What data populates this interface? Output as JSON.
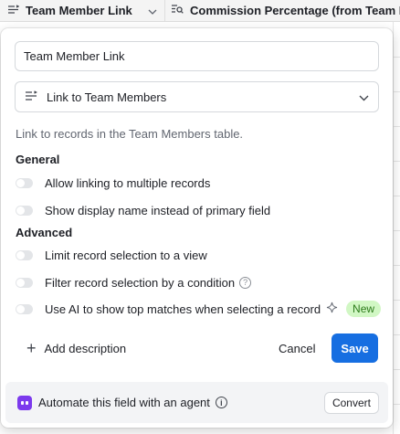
{
  "header": {
    "col1_label": "Team Member Link",
    "col1_icon": "linked-record-icon",
    "col2_label": "Commission Percentage (from Team Me",
    "col2_icon": "lookup-icon"
  },
  "dialog": {
    "field_name_value": "Team Member Link",
    "field_type": {
      "label": "Link to Team Members",
      "icon": "linked-record-icon"
    },
    "description": "Link to records in the Team Members table.",
    "general": {
      "title": "General",
      "options": [
        {
          "label": "Allow linking to multiple records",
          "enabled": false
        },
        {
          "label": "Show display name instead of primary field",
          "enabled": false
        }
      ]
    },
    "advanced": {
      "title": "Advanced",
      "options": [
        {
          "label": "Limit record selection to a view",
          "enabled": false
        },
        {
          "label": "Filter record selection by a condition",
          "enabled": false
        },
        {
          "label": "Use AI to show top matches when selecting a record",
          "enabled": false,
          "badge": "New"
        }
      ]
    },
    "add_description_label": "Add description",
    "cancel_label": "Cancel",
    "save_label": "Save",
    "agent": {
      "text": "Automate this field with an agent",
      "convert_label": "Convert"
    }
  },
  "colors": {
    "accent": "#166ee1",
    "badge_bg": "#d1f7c4",
    "badge_text": "#2b7a19",
    "agent_icon": "#7c3aed"
  }
}
